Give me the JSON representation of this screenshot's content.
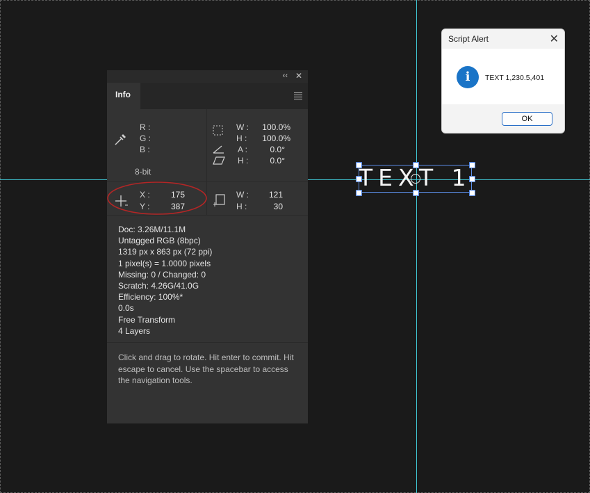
{
  "info_panel": {
    "tab_label": "Info",
    "collapse_icon": "double-chevron-left",
    "close_icon": "close-x",
    "menu_icon": "hamburger",
    "color": {
      "r_label": "R :",
      "g_label": "G :",
      "b_label": "B :",
      "bit_depth": "8-bit"
    },
    "transform": {
      "w_label": "W :",
      "w_value": "100.0%",
      "h_label": "H :",
      "h_value": "100.0%",
      "a_label": "A :",
      "a_value": "0.0°",
      "skew_h_label": "H :",
      "skew_h_value": "0.0°"
    },
    "position": {
      "x_label": "X :",
      "x_value": "175",
      "y_label": "Y :",
      "y_value": "387"
    },
    "size": {
      "w_label": "W :",
      "w_value": "121",
      "h_label": "H :",
      "h_value": "30"
    },
    "doc_info": [
      "Doc: 3.26M/11.1M",
      "Untagged RGB (8bpc)",
      "1319 px x 863 px (72 ppi)",
      "1 pixel(s) = 1.0000 pixels",
      "Missing: 0 / Changed: 0",
      "Scratch: 4.26G/41.0G",
      "Efficiency: 100%*",
      "0.0s",
      "Free Transform",
      "4 Layers"
    ],
    "hint": "Click and drag to rotate. Hit enter to commit. Hit escape to cancel. Use the spacebar to access the navigation tools."
  },
  "text_layer": {
    "content": "TEXT 1"
  },
  "alert": {
    "title": "Script Alert",
    "message": "TEXT 1,230.5,401",
    "ok_label": "OK",
    "info_icon_glyph": "i"
  },
  "colors": {
    "canvas_bg": "#1a1a1a",
    "guide": "#3fc6d3",
    "panel_bg": "#333333",
    "highlight_ellipse": "#b32626",
    "selection_blue": "#4a7fdc"
  }
}
